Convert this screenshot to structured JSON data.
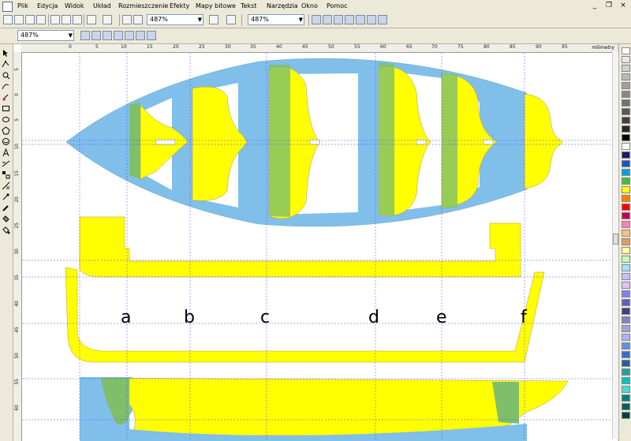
{
  "menu": {
    "items": [
      "Plik",
      "Edycja",
      "Widok",
      "Układ",
      "Rozmieszczenie",
      "Efekty",
      "Mapy bitowe",
      "Tekst",
      "Narzędzia",
      "Okno",
      "Pomoc"
    ],
    "window_controls": [
      "_",
      "❐",
      "×"
    ]
  },
  "toolbar": {
    "zoom_main": "487%",
    "zoom_second": "487%",
    "zoom_property": "487%"
  },
  "rulers": {
    "units": "milimetry",
    "h_ticks": [
      "0",
      "5",
      "10",
      "15",
      "20",
      "25",
      "30",
      "35",
      "40",
      "45",
      "50",
      "55",
      "60",
      "65",
      "70",
      "75",
      "80",
      "85",
      "90",
      "95"
    ],
    "v_ticks": [
      "5",
      "0",
      "5",
      "10",
      "15",
      "20",
      "25",
      "30",
      "35",
      "40",
      "45",
      "50",
      "55",
      "60"
    ]
  },
  "section_labels": [
    "a",
    "b",
    "c",
    "d",
    "e",
    "f"
  ],
  "colors": {
    "hull_blue": "#7fbfea",
    "frame_yellow": "#ffff00",
    "overlap_green": "#7fbf6a",
    "guide_blue": "#4a4aff",
    "outline_red": "#e04020"
  },
  "palette": [
    "#ffffff",
    "#e8e8e8",
    "#d0d0d0",
    "#b8b8b8",
    "#a0a0a0",
    "#888888",
    "#707070",
    "#585858",
    "#404040",
    "#282828",
    "#000000",
    "#ffffff",
    "#1a1a6e",
    "#2050c0",
    "#00a0e0",
    "#40c040",
    "#ffff00",
    "#ff8000",
    "#ff0000",
    "#c00060",
    "#ff80c0",
    "#ffc080",
    "#e0a060",
    "#ffffa0",
    "#c0ffc0",
    "#a0e0ff",
    "#c0c0ff",
    "#e0c0ff",
    "#8080ff",
    "#6060c0",
    "#404080",
    "#8080c0",
    "#a0a0e0",
    "#b0b0ff",
    "#6090e0",
    "#3070d0",
    "#2060a0",
    "#20a0a0",
    "#00c0c0",
    "#40e0d0",
    "#008080",
    "#006060",
    "#004040"
  ]
}
